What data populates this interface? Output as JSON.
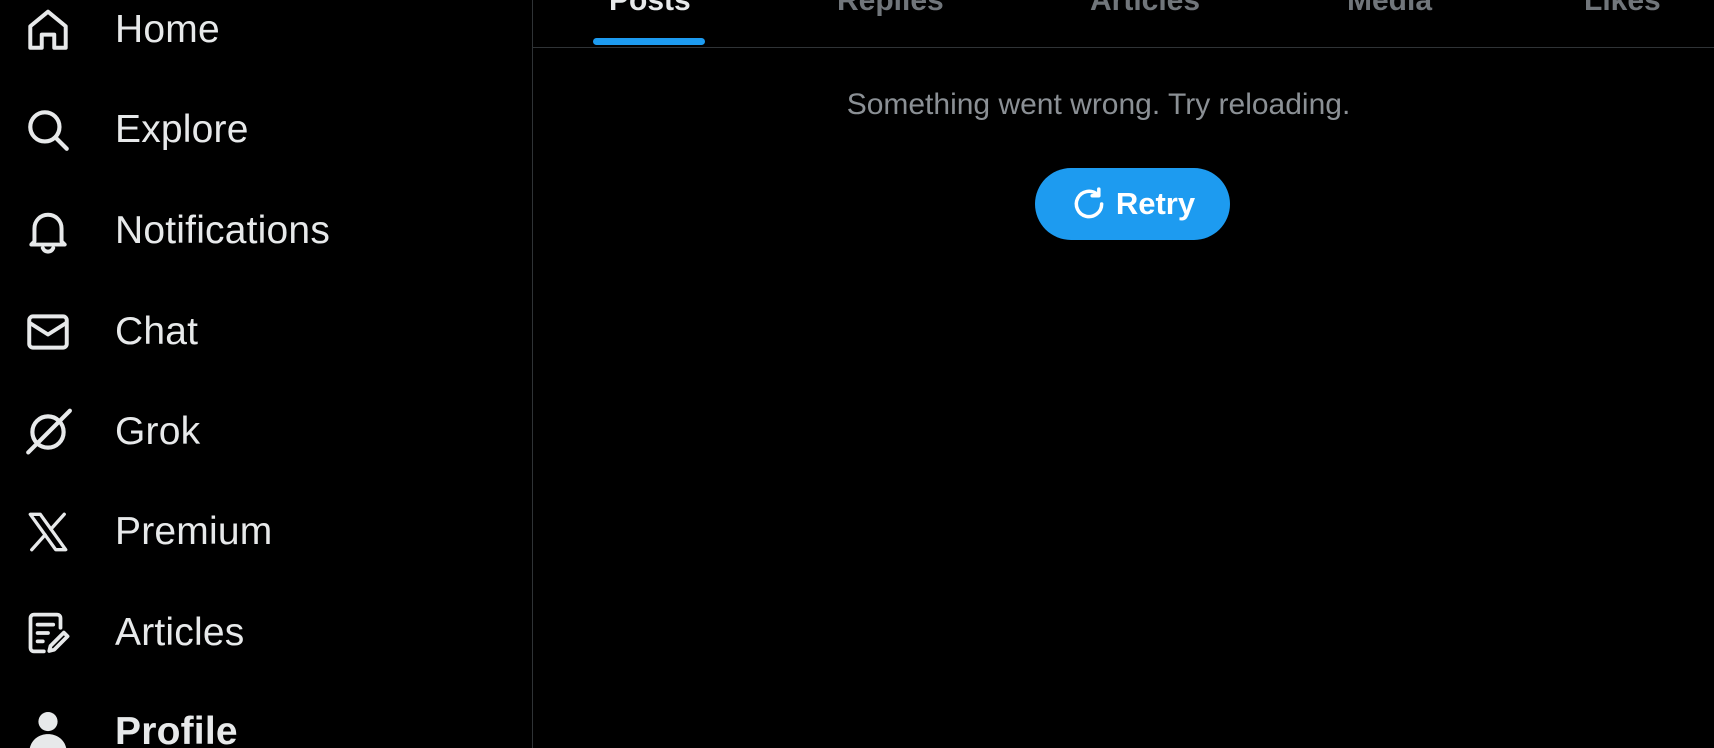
{
  "sidebar": {
    "items": [
      {
        "label": "Home",
        "icon": "home-icon"
      },
      {
        "label": "Explore",
        "icon": "search-icon"
      },
      {
        "label": "Notifications",
        "icon": "bell-icon"
      },
      {
        "label": "Chat",
        "icon": "mail-icon"
      },
      {
        "label": "Grok",
        "icon": "grok-icon"
      },
      {
        "label": "Premium",
        "icon": "x-logo-icon"
      },
      {
        "label": "Articles",
        "icon": "article-edit-icon"
      },
      {
        "label": "Profile",
        "icon": "person-icon",
        "active": true
      }
    ]
  },
  "main": {
    "tabs": [
      {
        "label": "Posts",
        "active": true
      },
      {
        "label": "Replies"
      },
      {
        "label": "Articles"
      },
      {
        "label": "Media"
      },
      {
        "label": "Likes"
      }
    ],
    "error_message": "Something went wrong. Try reloading.",
    "retry_label": "Retry",
    "retry_icon": "refresh-icon"
  },
  "colors": {
    "background": "#000000",
    "text_primary": "#e7e9ea",
    "text_secondary": "#71767b",
    "accent": "#1d9bf0",
    "divider": "#2f3336"
  }
}
